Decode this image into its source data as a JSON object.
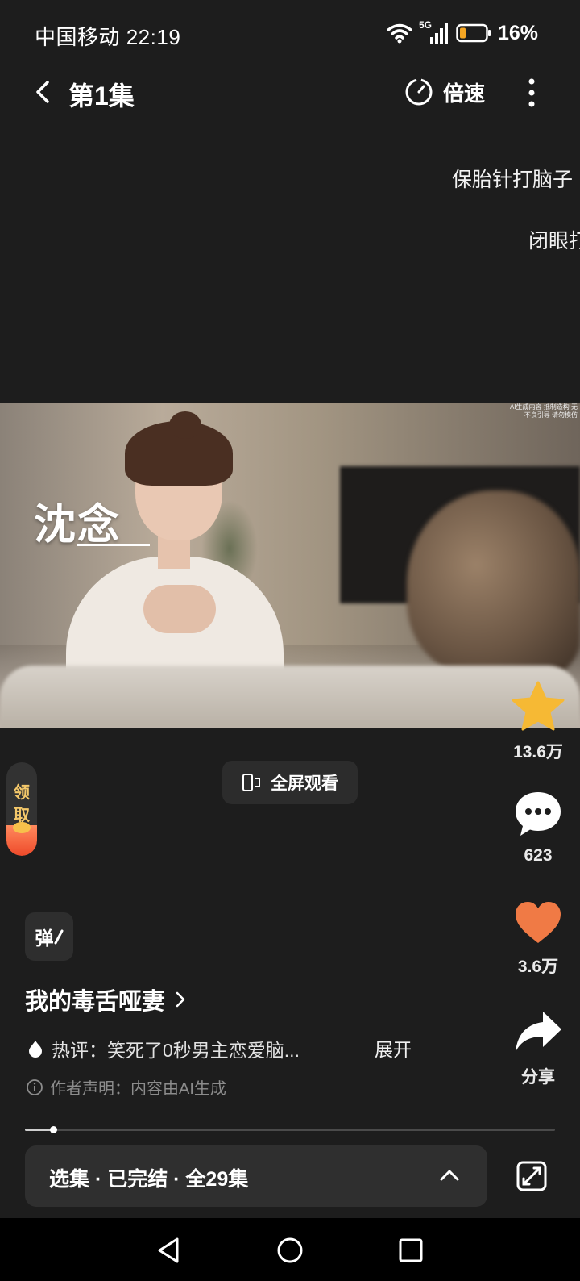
{
  "status_bar": {
    "carrier_time": "中国移动 22:19",
    "network": "5G",
    "battery": "16%"
  },
  "header": {
    "episode_title": "第1集",
    "speed_label": "倍速"
  },
  "danmaku": [
    "保胎针打脑子",
    "闭眼打"
  ],
  "video": {
    "name_tag": "沈念",
    "ai_watermark": "AI生成内容 抵制造构 无不良引导 请勿模仿"
  },
  "actions": {
    "favorite_count": "13.6万",
    "comment_count": "623",
    "like_count": "3.6万",
    "share_label": "分享"
  },
  "reward": {
    "label": "领取"
  },
  "fullscreen": {
    "label": "全屏观看"
  },
  "danmu_toggle": {
    "label": "弹"
  },
  "series": {
    "title": "我的毒舌哑妻",
    "hot_comment": "热评：笑死了0秒男主恋爱脑...",
    "expand_label": "展开",
    "disclaimer": "作者声明：内容由AI生成"
  },
  "progress": {
    "fraction": 0.053
  },
  "episode_bar": {
    "label": "选集 · 已完结 · 全29集"
  },
  "colors": {
    "background": "#1d1d1d",
    "star": "#f6b934",
    "heart": "#f07a45",
    "reward_text": "#f4c86a"
  },
  "icons": {
    "back": "chevron-left-icon",
    "speed": "timer-icon",
    "more": "more-vertical-icon",
    "favorite": "star-icon",
    "comment": "chat-bubble-icon",
    "like": "heart-icon",
    "share": "share-arrow-icon",
    "fullscreen": "rotate-phone-icon",
    "hot": "flame-icon",
    "info": "info-circle-icon",
    "expand_episodes": "chevron-up-icon",
    "pip": "picture-in-picture-icon"
  }
}
